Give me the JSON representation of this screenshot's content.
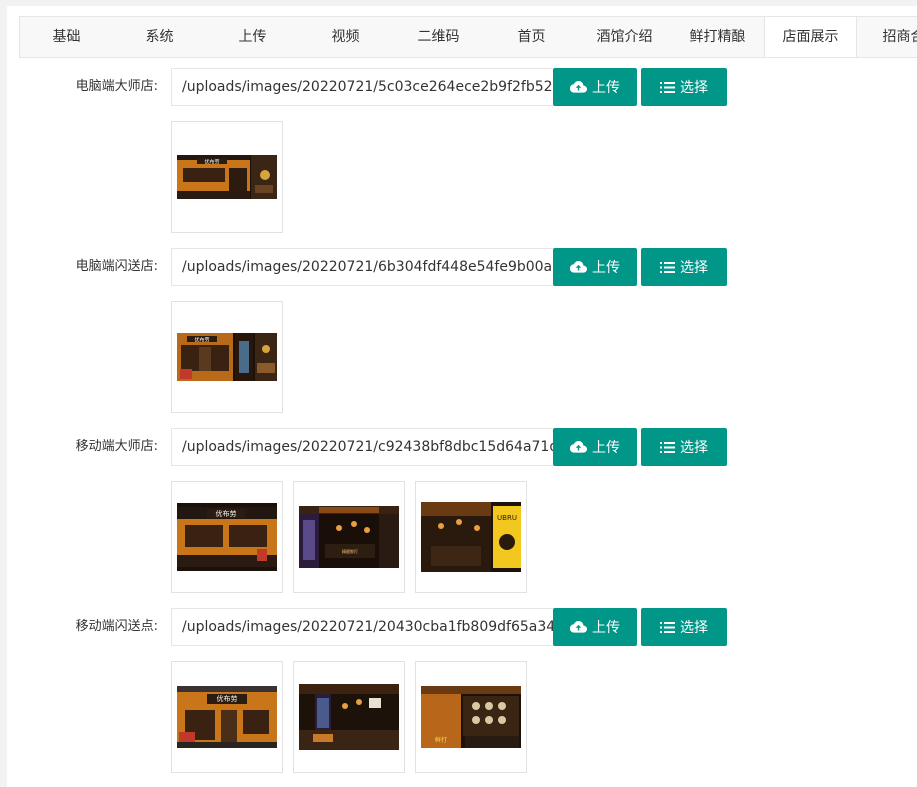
{
  "tabs": [
    "基础",
    "系统",
    "上传",
    "视频",
    "二维码",
    "首页",
    "酒馆介绍",
    "鲜打精酿",
    "店面展示",
    "招商合"
  ],
  "active_tab": "店面展示",
  "buttons": {
    "upload": "上传",
    "choose": "选择"
  },
  "rows": [
    {
      "label": "电脑端大师店:",
      "path": "/uploads/images/20220721/5c03ce264ece2b9f2fb5291033"
    },
    {
      "label": "电脑端闪送店:",
      "path": "/uploads/images/20220721/6b304fdf448e54fe9b00a5340d"
    },
    {
      "label": "移动端大师店:",
      "path": "/uploads/images/20220721/c92438bf8dbc15d64a71d235e"
    },
    {
      "label": "移动端闪送点:",
      "path": "/uploads/images/20220721/20430cba1fb809df65a342069a"
    }
  ],
  "colors": {
    "accent": "#009688"
  }
}
